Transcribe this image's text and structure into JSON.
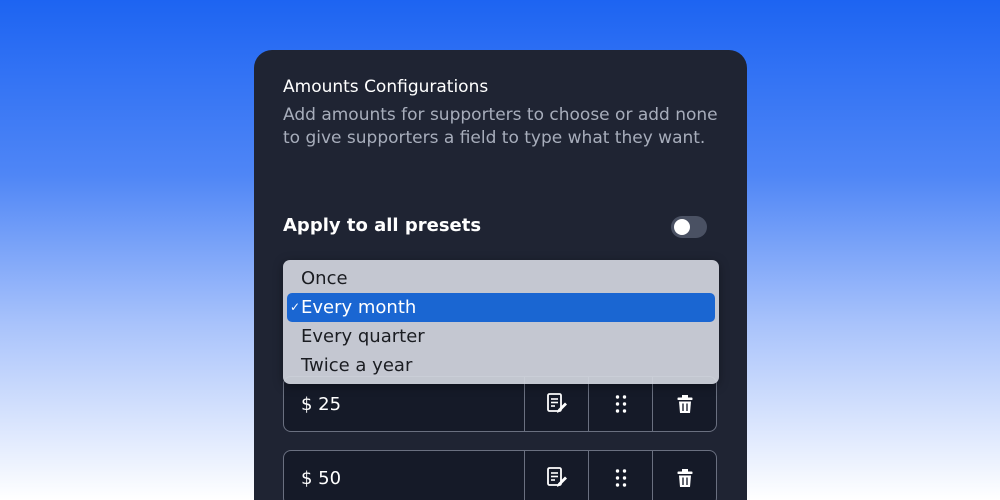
{
  "panel": {
    "title": "Amounts Configurations",
    "description": "Add amounts for supporters to choose or add none to give supporters a field to type what they want.",
    "apply_all": {
      "label": "Apply to all presets",
      "toggle_on": false
    }
  },
  "frequency_dropdown": {
    "options": [
      "Once",
      "Every month",
      "Every quarter",
      "Twice a year"
    ],
    "selected": "Every month",
    "check_mark": "✓"
  },
  "amounts": [
    {
      "value": "$ 25"
    },
    {
      "value": "$ 50"
    }
  ],
  "icons": {
    "edit": "edit-note-icon",
    "drag": "drag-handle-icon",
    "delete": "trash-icon"
  },
  "colors": {
    "background_top": "#1d64f2",
    "panel": "#1f2433",
    "selected_option": "#1a66d2"
  }
}
